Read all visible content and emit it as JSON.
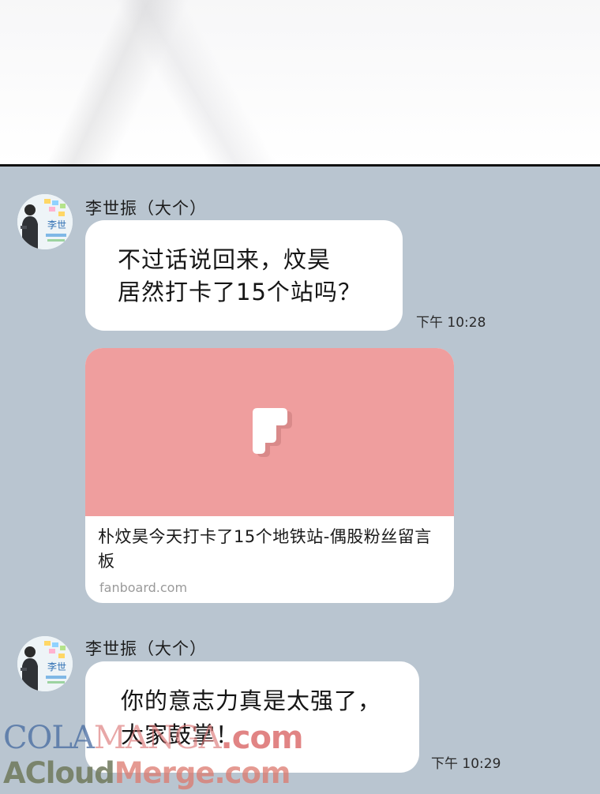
{
  "messages": [
    {
      "sender": "李世振（大个）",
      "avatar_label": "李世",
      "line1": "不过话说回来，炆昊",
      "line2": "居然打卡了15个站吗？",
      "time": "下午 10:28"
    },
    {
      "sender": "李世振（大个）",
      "avatar_label": "李世",
      "line1": "你的意志力真是太强了，",
      "line2": "大家鼓掌！",
      "time": "下午 10:29"
    }
  ],
  "link_card": {
    "icon": "fanboard-logo-icon",
    "title": "朴炆昊今天打卡了15个地铁站-偶股粉丝留言板",
    "domain": "fanboard.com"
  },
  "watermark": {
    "line1_a": "COLA",
    "line1_b": "MANGA",
    "line1_c": ".com",
    "line2_a": "ACloud",
    "line2_b": "Merge.com"
  },
  "colors": {
    "chat_background": "#b9c5d0",
    "bubble": "#ffffff",
    "card_thumbnail": "#ef9e9e"
  }
}
